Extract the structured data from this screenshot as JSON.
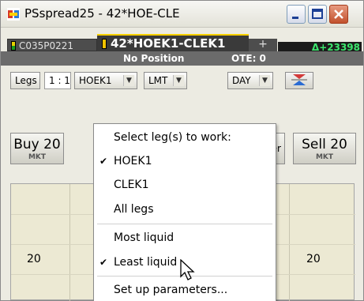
{
  "window": {
    "title": "PSspread25 - 42*HOE-CLE",
    "icon": "spread-app-icon",
    "controls": [
      "minimize-icon",
      "maximize-icon",
      "close-icon"
    ]
  },
  "tabs": [
    {
      "label": "C035P0221",
      "active": false
    },
    {
      "label": "42*HOEK1-CLEK1",
      "active": true
    },
    {
      "label": "+",
      "active": false
    }
  ],
  "delta_badge": "Δ+23398",
  "position_bar": {
    "position": "No Position",
    "ote": "OTE: 0"
  },
  "toolbar": {
    "legs_label": "Legs",
    "ratio_value": "1 : 1",
    "leg_select": "HOEK1",
    "order_type": "LMT",
    "duration": "DAY",
    "swap_icon": "swap-arrows-icon"
  },
  "trade": {
    "buy_label": "Buy 20",
    "buy_sub": "MKT",
    "sell_label": "Sell 20",
    "sell_sub": "MKT",
    "partial_label": "er"
  },
  "grid": {
    "left_value": "20",
    "right_value": "20"
  },
  "menu": {
    "items": [
      {
        "label": "Select leg(s) to work:",
        "checked": false
      },
      {
        "label": "HOEK1",
        "checked": true
      },
      {
        "label": "CLEK1",
        "checked": false
      },
      {
        "label": "All legs",
        "checked": false
      },
      {
        "label": "Most liquid",
        "checked": false
      },
      {
        "label": "Least liquid",
        "checked": true
      },
      {
        "label": "Set up parameters...",
        "checked": false
      }
    ],
    "check_glyph": "✔"
  },
  "colors": {
    "accent_tab": "#ffd000",
    "delta_text": "#3ce66d",
    "close_button": "#c2512d",
    "grid_bg": "#ece9d3"
  }
}
